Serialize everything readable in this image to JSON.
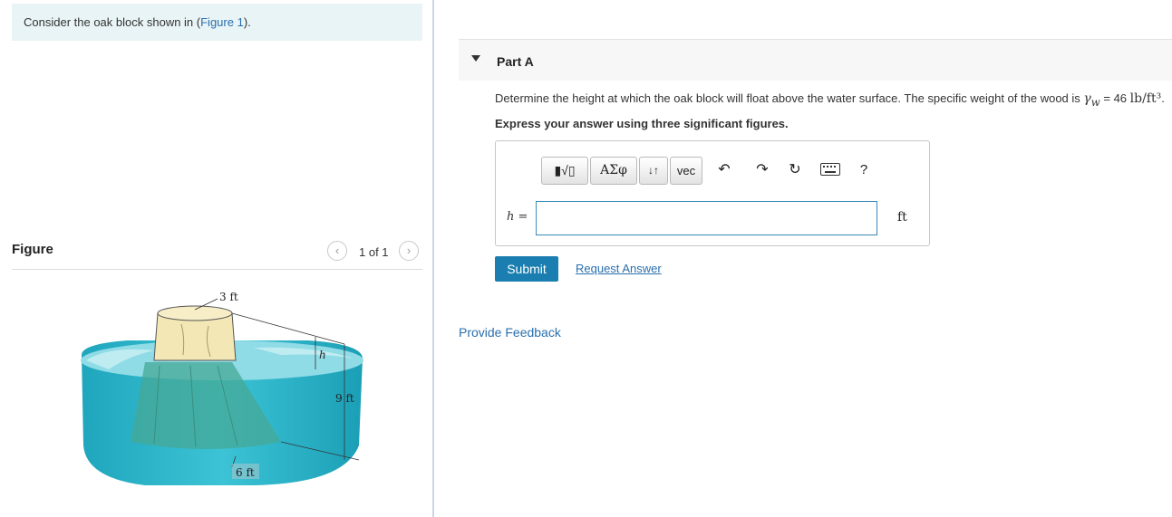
{
  "left_panel": {
    "intro_prefix": "Consider the oak block shown in (",
    "intro_link": "Figure 1",
    "intro_suffix": ").",
    "figure_title": "Figure",
    "pager": {
      "prev_glyph": "‹",
      "next_glyph": "›",
      "text": "1 of 1"
    },
    "figure_labels": {
      "top_diameter": "3 ft",
      "height_above": "h",
      "total_height": "9 ft",
      "bottom_diameter": "6 ft"
    }
  },
  "part": {
    "title": "Part A",
    "question_text": "Determine the height at which the oak block will float above the water surface. The specific weight of the wood is ",
    "gamma_symbol": "γ",
    "gamma_sub": "w",
    "gamma_value": " = 46 ",
    "gamma_unit": "lb/ft³",
    "question_end": ".",
    "instruction": "Express your answer using three significant figures.",
    "toolbar": {
      "templates_label": "▮√▯",
      "greek_label": "ΑΣφ",
      "arrows_label": "↓↑",
      "vec_label": "vec",
      "undo_glyph": "↶",
      "redo_glyph": "↷",
      "reset_glyph": "↻",
      "help_glyph": "?"
    },
    "answer": {
      "variable": "h",
      "equals": " =",
      "value": "",
      "unit": "ft"
    },
    "submit_label": "Submit",
    "request_label": "Request Answer"
  },
  "feedback_label": "Provide Feedback",
  "colors": {
    "accent": "#1a7fb0",
    "link": "#2a6fae",
    "intro_bg": "#e9f4f6",
    "water": "#2fb3c8",
    "wood": "#f3e7b5"
  },
  "icons": [
    "undo-icon",
    "redo-icon",
    "reset-icon",
    "keyboard-icon",
    "help-icon",
    "caret-down-icon",
    "chevron-left-icon",
    "chevron-right-icon"
  ]
}
